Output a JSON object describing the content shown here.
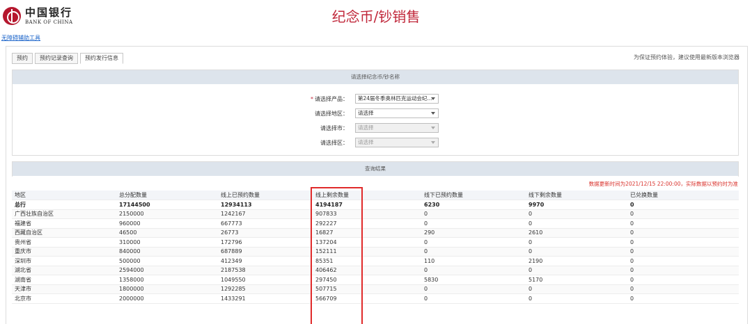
{
  "header": {
    "logo_cn": "中国银行",
    "logo_en": "BANK OF CHINA",
    "title": "纪念币/钞销售"
  },
  "accessibility_link": "无障碍辅助工具",
  "tabs": [
    {
      "label": "预约",
      "active": false
    },
    {
      "label": "预约记录查询",
      "active": false
    },
    {
      "label": "预约发行信息",
      "active": true
    }
  ],
  "browser_tip": "为保证预约体验，建议使用最新版本浏览器",
  "select_section": {
    "title": "请选择纪念币/钞名称",
    "fields": {
      "product": {
        "required": true,
        "label": "请选择产品：",
        "value": "第24届冬季奥林匹克运动会纪...",
        "disabled": false
      },
      "region": {
        "required": false,
        "label": "请选择地区：",
        "value": "请选择",
        "disabled": false
      },
      "city": {
        "required": false,
        "label": "请选择市：",
        "value": "请选择",
        "disabled": true
      },
      "district": {
        "required": false,
        "label": "请选择区：",
        "value": "请选择",
        "disabled": true
      }
    },
    "required_mark": "*"
  },
  "results_section": {
    "title": "查询结果",
    "update_note": "数据更新时间为2021/12/15 22:00:00，实际数据以预约时为准"
  },
  "table": {
    "columns": [
      "地区",
      "总分配数量",
      "线上已预约数量",
      "线上剩余数量",
      "线下已预约数量",
      "线下剩余数量",
      "已兑换数量"
    ],
    "rows": [
      {
        "total": true,
        "cells": [
          "总行",
          "17144500",
          "12934113",
          "4194187",
          "6230",
          "9970",
          "0"
        ]
      },
      {
        "total": false,
        "cells": [
          "广西壮族自治区",
          "2150000",
          "1242167",
          "907833",
          "0",
          "0",
          "0"
        ]
      },
      {
        "total": false,
        "cells": [
          "福建省",
          "960000",
          "667773",
          "292227",
          "0",
          "0",
          "0"
        ]
      },
      {
        "total": false,
        "cells": [
          "西藏自治区",
          "46500",
          "26773",
          "16827",
          "290",
          "2610",
          "0"
        ]
      },
      {
        "total": false,
        "cells": [
          "贵州省",
          "310000",
          "172796",
          "137204",
          "0",
          "0",
          "0"
        ]
      },
      {
        "total": false,
        "cells": [
          "重庆市",
          "840000",
          "687889",
          "152111",
          "0",
          "0",
          "0"
        ]
      },
      {
        "total": false,
        "cells": [
          "深圳市",
          "500000",
          "412349",
          "85351",
          "110",
          "2190",
          "0"
        ]
      },
      {
        "total": false,
        "cells": [
          "湖北省",
          "2594000",
          "2187538",
          "406462",
          "0",
          "0",
          "0"
        ]
      },
      {
        "total": false,
        "cells": [
          "湖南省",
          "1358000",
          "1049550",
          "297450",
          "5830",
          "5170",
          "0"
        ]
      },
      {
        "total": false,
        "cells": [
          "天津市",
          "1800000",
          "1292285",
          "507715",
          "0",
          "0",
          "0"
        ]
      },
      {
        "total": false,
        "cells": [
          "北京市",
          "2000000",
          "1433291",
          "566709",
          "0",
          "0",
          "0"
        ]
      }
    ]
  },
  "colors": {
    "brand_red": "#c0273a",
    "section_bar": "#dde4ec",
    "highlight": "#e02a2a",
    "note_red": "#d9312b"
  }
}
